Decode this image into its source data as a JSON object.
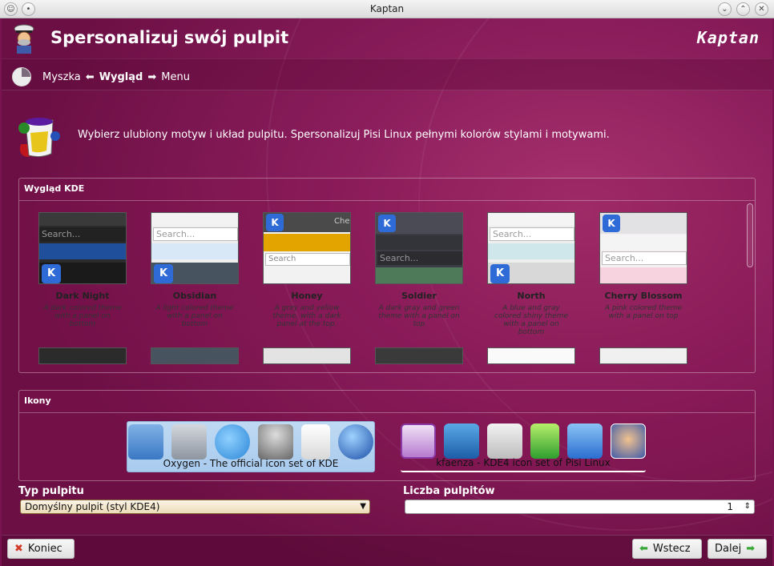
{
  "window": {
    "title": "Kaptan"
  },
  "header": {
    "title": "Spersonalizuj swój pulpit",
    "logo_text": "Kaptan"
  },
  "breadcrumb": {
    "items": [
      "Myszka",
      "Wygląd",
      "Menu"
    ]
  },
  "intro": {
    "text": "Wybierz ulubiony motyw i układ pulpitu. Spersonalizuj Pisi Linux pełnymi kolorów stylami i motywami."
  },
  "kde_look": {
    "title": "Wygląd KDE",
    "themes": [
      {
        "name": "Dark Night",
        "desc": "A dark colored theme with a panel on bottom",
        "search_text": "Search..."
      },
      {
        "name": "Obsidian",
        "desc": "A light colored theme with a panel on bottom",
        "search_text": "Search..."
      },
      {
        "name": "Honey",
        "desc": "A grey and yellow theme, with a dark panel at the top.",
        "search_text": "Search"
      },
      {
        "name": "Soldier",
        "desc": "A dark gray and green theme with a panel on top",
        "search_text": "Search..."
      },
      {
        "name": "North",
        "desc": "A blue and gray colored shiny theme with a panel on bottom",
        "search_text": "Search..."
      },
      {
        "name": "Cherry Blossom",
        "desc": "A pink colored theme with a panel on top",
        "search_text": "Search..."
      }
    ],
    "thumb_tab_text": "Che"
  },
  "icons": {
    "title": "Ikony",
    "sets": [
      {
        "label": "Oxygen - The official icon set of KDE",
        "selected": true
      },
      {
        "label": "kfaenza - KDE4 icon set of Pisi Linux",
        "selected": false
      }
    ]
  },
  "desktop_type": {
    "label": "Typ pulpitu",
    "value": "Domyślny pulpit (styl KDE4)"
  },
  "desktop_count": {
    "label": "Liczba pulpitów",
    "value": "1"
  },
  "buttons": {
    "quit": "Koniec",
    "back": "Wstecz",
    "next": "Dalej"
  }
}
